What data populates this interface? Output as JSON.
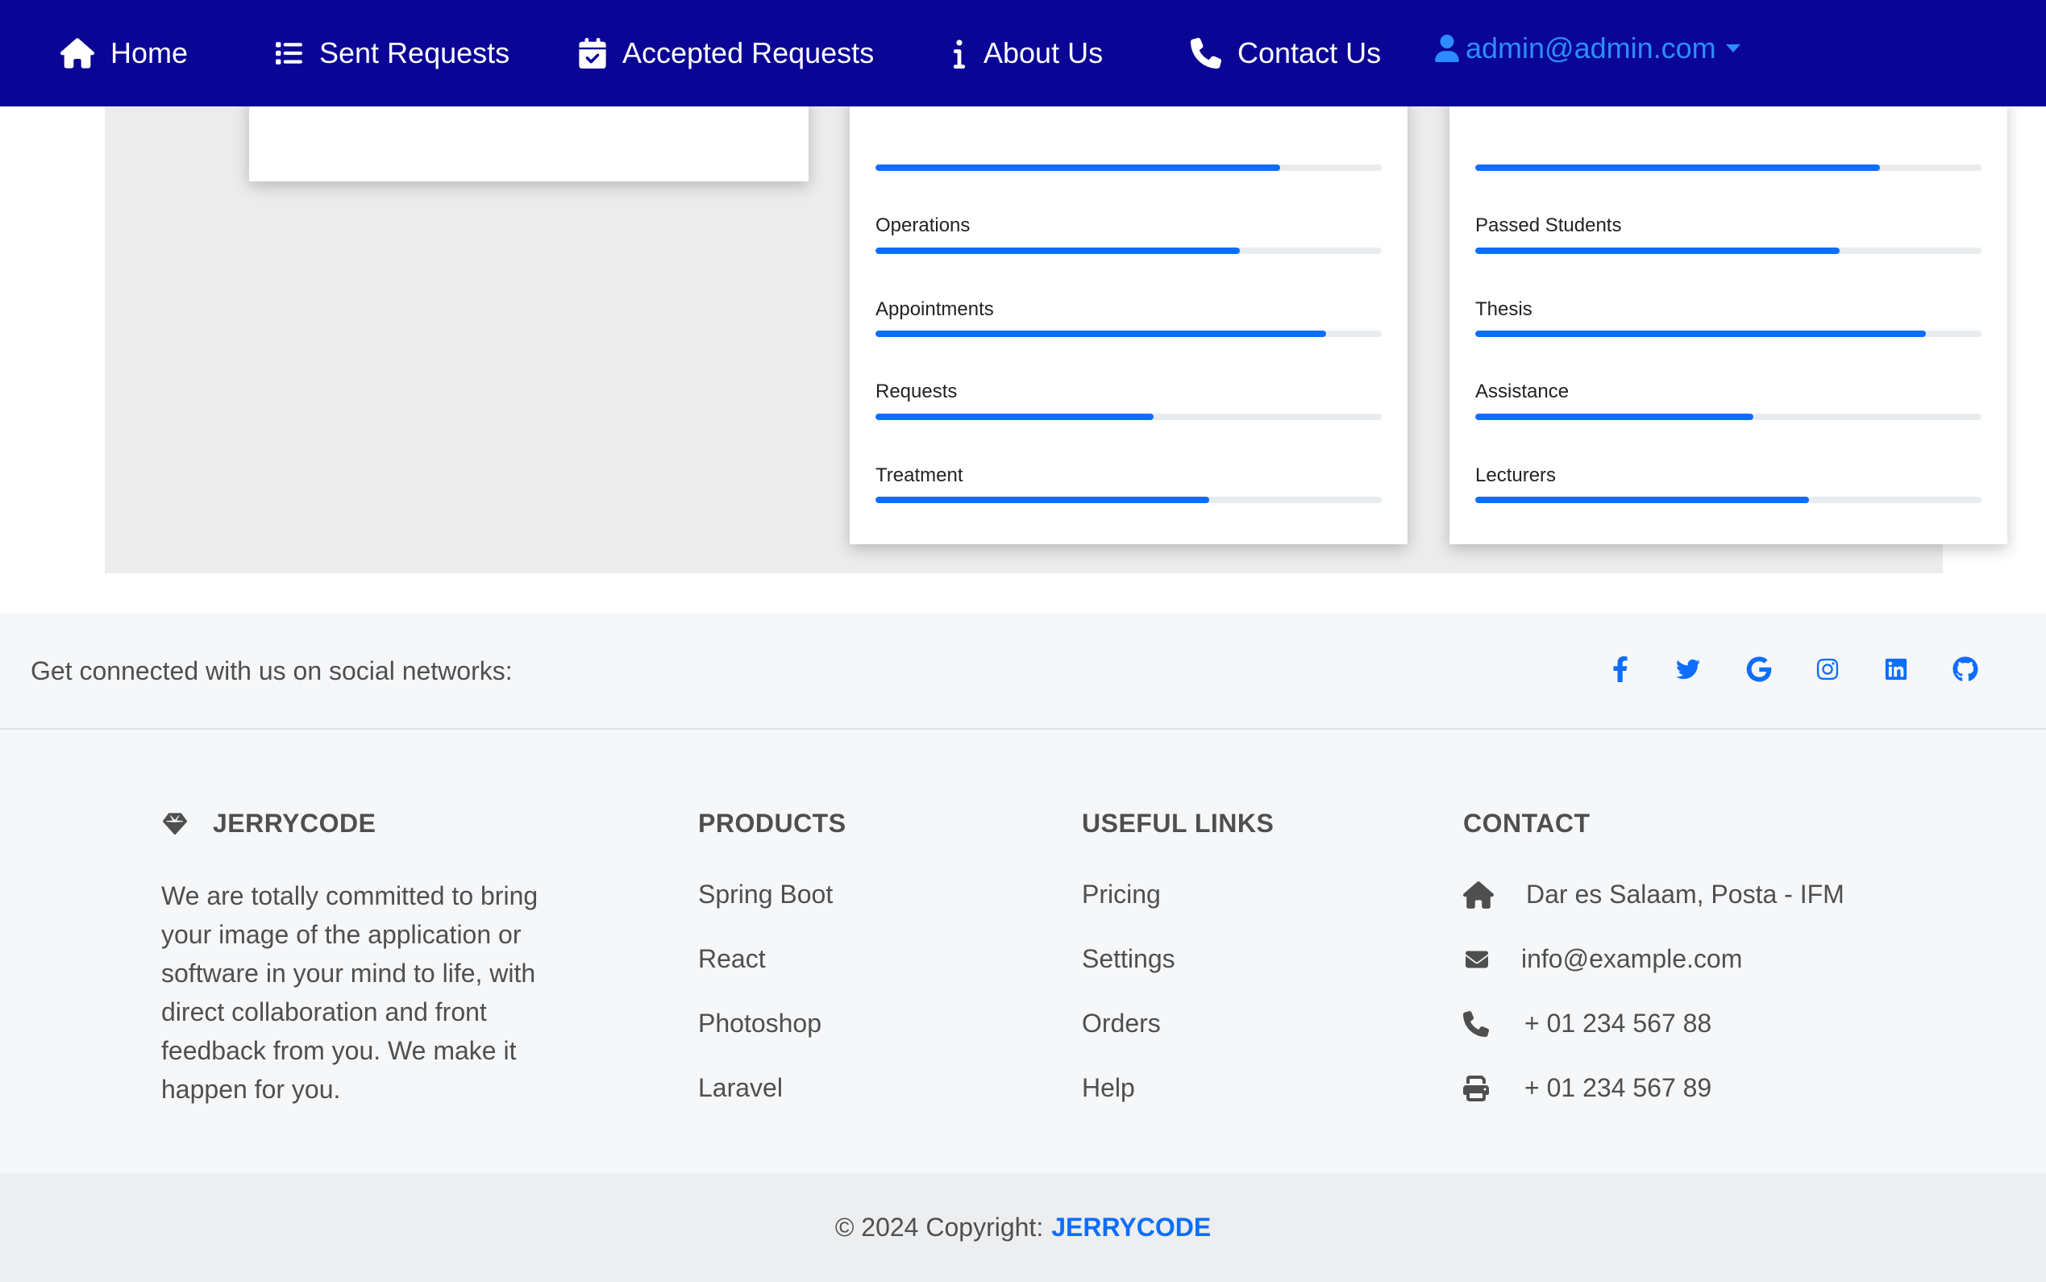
{
  "nav": {
    "items": [
      {
        "label": "Home",
        "icon": "home-icon"
      },
      {
        "label": "Sent Requests",
        "icon": "list-icon"
      },
      {
        "label": "Accepted Requests",
        "icon": "calendar-check-icon"
      },
      {
        "label": "About Us",
        "icon": "info-icon"
      },
      {
        "label": "Contact Us",
        "icon": "phone-icon"
      }
    ],
    "user": "admin@admin.com"
  },
  "stats": {
    "middle": [
      {
        "label": "Operations",
        "percent": 72
      },
      {
        "label": "Appointments",
        "percent": 89
      },
      {
        "label": "Requests",
        "percent": 55
      },
      {
        "label": "Treatment",
        "percent": 66
      }
    ],
    "middle_top_percent": 80,
    "right": [
      {
        "label": "Passed Students",
        "percent": 72
      },
      {
        "label": "Thesis",
        "percent": 89
      },
      {
        "label": "Assistance",
        "percent": 55
      },
      {
        "label": "Lecturers",
        "percent": 66
      }
    ],
    "right_top_percent": 80
  },
  "social": {
    "text": "Get connected with us on social networks:",
    "icons": [
      "facebook-icon",
      "twitter-icon",
      "google-icon",
      "instagram-icon",
      "linkedin-icon",
      "github-icon"
    ]
  },
  "footer": {
    "brand": "JERRYCODE",
    "about": "We are totally committed to bring your image of the application or software in your mind to life, with direct collaboration and front feedback from you. We make it happen for you.",
    "products_title": "PRODUCTS",
    "products": [
      "Spring Boot",
      "React",
      "Photoshop",
      "Laravel"
    ],
    "links_title": "USEFUL LINKS",
    "links": [
      "Pricing",
      "Settings",
      "Orders",
      "Help"
    ],
    "contact_title": "CONTACT",
    "contact": [
      {
        "icon": "home-icon",
        "text": "Dar es Salaam, Posta - IFM"
      },
      {
        "icon": "envelope-icon",
        "text": "info@example.com"
      },
      {
        "icon": "phone-icon",
        "text": "+ 01 234 567 88"
      },
      {
        "icon": "print-icon",
        "text": "+ 01 234 567 89"
      }
    ]
  },
  "copyright": {
    "text": "© 2024 Copyright:",
    "brand": "JERRYCODE"
  },
  "colors": {
    "navbar": "#0a0595",
    "accent": "#0d6efd",
    "text": "#4f4f4f"
  }
}
